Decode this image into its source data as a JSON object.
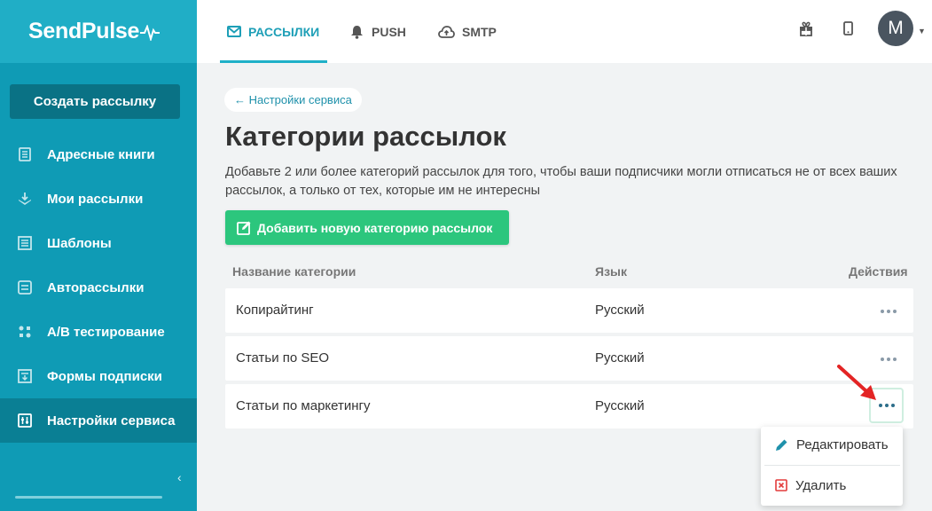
{
  "brand": {
    "logo_text": "SendPulse"
  },
  "sidebar": {
    "create_label": "Создать рассылку",
    "items": [
      {
        "label": "Адресные книги",
        "icon": "address-book-icon"
      },
      {
        "label": "Мои рассылки",
        "icon": "campaigns-icon"
      },
      {
        "label": "Шаблоны",
        "icon": "templates-icon"
      },
      {
        "label": "Авторассылки",
        "icon": "automation-icon"
      },
      {
        "label": "A/B тестирование",
        "icon": "ab-test-icon"
      },
      {
        "label": "Формы подписки",
        "icon": "forms-icon"
      },
      {
        "label": "Настройки сервиса",
        "icon": "settings-icon",
        "active": true
      }
    ],
    "collapse_glyph": "‹"
  },
  "topbar": {
    "tabs": [
      {
        "label": "РАССЫЛКИ",
        "icon": "mail-icon",
        "active": true
      },
      {
        "label": "PUSH",
        "icon": "bell-icon"
      },
      {
        "label": "SMTP",
        "icon": "cloud-icon"
      }
    ],
    "avatar_letter": "M"
  },
  "main": {
    "back_label": "← Настройки сервиса",
    "title": "Категории рассылок",
    "description": "Добавьте 2 или более категорий рассылок для того, чтобы ваши подписчики могли отписаться не от всех ваших рассылок, а только от тех, которые им не интересны",
    "add_button_label": "Добавить новую категорию рассылок",
    "table": {
      "columns": [
        "Название категории",
        "Язык",
        "Действия"
      ],
      "rows": [
        {
          "name": "Копирайтинг",
          "lang": "Русский"
        },
        {
          "name": "Статьи по SEO",
          "lang": "Русский"
        },
        {
          "name": "Статьи по маркетингу",
          "lang": "Русский"
        }
      ]
    },
    "menu": {
      "edit_label": "Редактировать",
      "delete_label": "Удалить"
    }
  },
  "colors": {
    "sidebar": "#0f9bb5",
    "accent": "#1fb0c8",
    "green": "#2cc67d",
    "arrow": "#e32424"
  }
}
